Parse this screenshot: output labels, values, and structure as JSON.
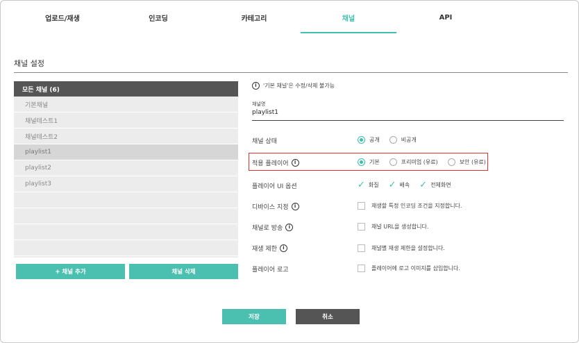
{
  "tabs": [
    {
      "label": "업로드/재생"
    },
    {
      "label": "인코딩"
    },
    {
      "label": "카테고리"
    },
    {
      "label": "채널"
    },
    {
      "label": "API"
    }
  ],
  "active_tab": "채널",
  "section_title": "채널 설정",
  "channel_list": {
    "header": "모든 채널 (6)",
    "items": [
      "기본채널",
      "채널테스트1",
      "채널테스트2",
      "playlist1",
      "playlist2",
      "playlist3"
    ],
    "selected": "playlist1"
  },
  "buttons": {
    "add_channel": "+ 채널 추가",
    "delete_channel": "채널 삭제",
    "save": "저장",
    "cancel": "취소"
  },
  "info_note": "'기본 채널'은 수정/삭제 불가능",
  "channel_name": {
    "label": "채널명",
    "value": "playlist1"
  },
  "settings": {
    "status": {
      "label": "채널 상태",
      "options": [
        "공개",
        "비공개"
      ],
      "selected": "공개"
    },
    "player": {
      "label": "적용 플레이어",
      "options": [
        "기본",
        "프리미엄 (유료)",
        "보안 (유료)"
      ],
      "selected": "기본"
    },
    "player_ui": {
      "label": "플레이어 UI 옵션",
      "options": [
        "화질",
        "배속",
        "전체화면"
      ]
    },
    "device": {
      "label": "디바이스 지정",
      "text": "재생할 특정 인코딩 조건을 지정합니다."
    },
    "broadcast": {
      "label": "채널로 방송",
      "text": "채널 URL을 생성합니다."
    },
    "playback_limit": {
      "label": "재생 제한",
      "text": "채널별 재생 제한을 설정합니다."
    },
    "player_logo": {
      "label": "플레이어 로고",
      "text": "플레이어에 로고 이미지를 삽입합니다."
    }
  },
  "colors": {
    "accent": "#3fbfb0",
    "dark": "#555555",
    "highlight": "#e03030"
  },
  "icons": {
    "info": "info-circle-icon",
    "check": "checkmark-icon"
  }
}
